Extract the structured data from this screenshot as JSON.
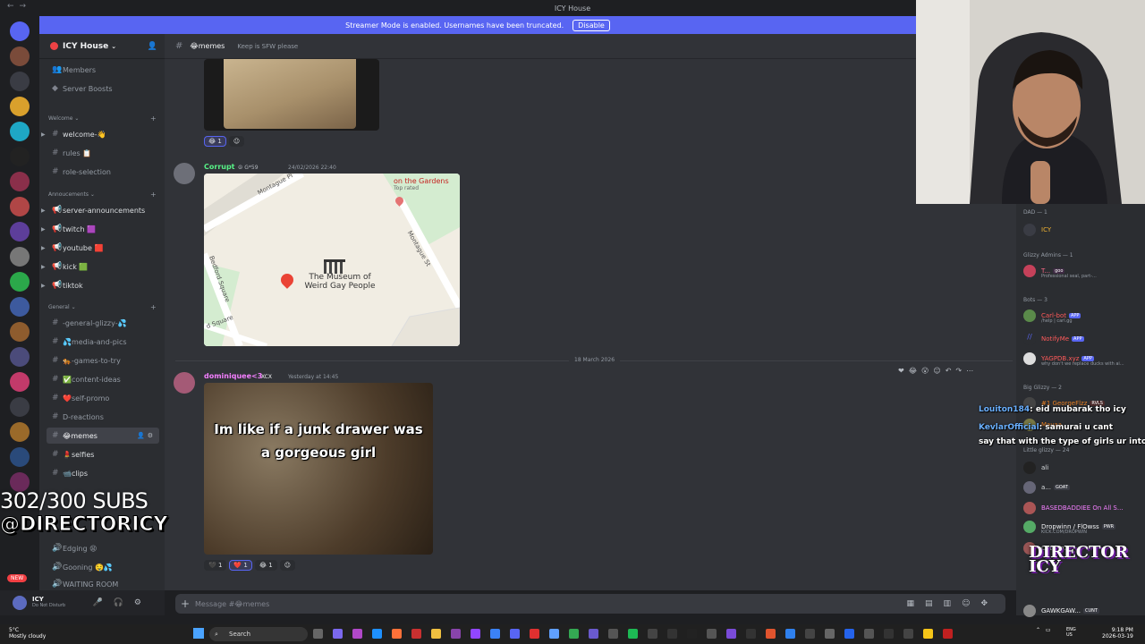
{
  "window": {
    "title": "ICY House"
  },
  "banner": {
    "text": "Streamer Mode is enabled. Usernames have been truncated.",
    "button": "Disable"
  },
  "server": {
    "name": "ICY House"
  },
  "sidebar": {
    "top_items": [
      {
        "label": "Members"
      },
      {
        "label": "Server Boosts"
      }
    ],
    "categories": [
      {
        "label": "Welcome",
        "channels": [
          "welcome-👋",
          "rules 📋",
          "role-selection"
        ]
      },
      {
        "label": "Annoucements",
        "channels": [
          "server-announcements",
          "twitch 🟪",
          "youtube 🟥",
          "kick 🟩",
          "tiktok"
        ]
      },
      {
        "label": "General",
        "channels": [
          "-general-glizzy-💦",
          "💦media-and-pics",
          "🐅-games-to-try",
          "✅content-ideas",
          "❤️self-promo",
          "D-reactions",
          "😂memes",
          "💄selfies",
          "📹clips"
        ]
      }
    ],
    "voice": [
      "Gooning 🤤💦",
      "WAITING ROOM",
      "Edging 😫"
    ]
  },
  "user": {
    "name": "ICY",
    "status": "Do Not Disturb"
  },
  "channel": {
    "name": "😂memes",
    "topic": "Keep is SFW please"
  },
  "messages": [
    {
      "reactions": [
        {
          "emoji": "😂",
          "count": "1"
        }
      ]
    },
    {
      "author": "Corrupt",
      "badge": "☮ G*59",
      "time": "24/02/2026 22:40",
      "map": {
        "place": "The Museum of Weird Gay People",
        "nearby": "on the Gardens",
        "nearby_sub": "Top rated",
        "streets": [
          "Montague Pl",
          "Montague St",
          "Bedford Square",
          "d Square"
        ]
      }
    },
    {
      "author": "dominiquee<3",
      "badge": "XCX",
      "time": "Yesterday at 14:45",
      "meme_caption": "Im like if a junk drawer was a gorgeous girl",
      "reactions": [
        {
          "emoji": "🖤",
          "count": "1"
        },
        {
          "emoji": "❤️",
          "count": "1"
        },
        {
          "emoji": "😂",
          "count": "1"
        }
      ]
    }
  ],
  "date_divider": "18 March 2026",
  "composer": {
    "placeholder": "Message #😂memes"
  },
  "members": {
    "groups": [
      {
        "label": "DAD — 1",
        "items": [
          {
            "name": "ICY"
          }
        ]
      },
      {
        "label": "Glizzy Admins — 1",
        "items": [
          {
            "name": "T...",
            "tag": "goo",
            "sub": "Professional seal, part-..."
          }
        ]
      },
      {
        "label": "Bots — 3",
        "items": [
          {
            "name": "Carl-bot",
            "tag": "APP",
            "sub": "/help | carl.gg"
          },
          {
            "name": "NotifyMe",
            "tag": "APP"
          },
          {
            "name": "YAGPDB.xyz",
            "tag": "APP",
            "sub": "why don't we replace ducks with ai..."
          }
        ]
      },
      {
        "label": "Big Glizzy — 2",
        "items": [
          {
            "name": "#1 GeorgeFlzz",
            "tag": "RVLS"
          },
          {
            "name": "Mayaa"
          }
        ]
      },
      {
        "label": "Little glizzy — 24",
        "items": [
          {
            "name": "ali"
          },
          {
            "name": "a...",
            "tag": "GOAT"
          },
          {
            "name": "BASEDBADDIEE On All S..."
          },
          {
            "name": "Dropwinn / FlOwss",
            "tag": "PWR",
            "sub": "KICK.COM/DROPWIN"
          },
          {
            "name": "Cutting..."
          },
          {
            "name": "GAWKGAW...",
            "tag": "CUNT"
          }
        ]
      }
    ]
  },
  "stream_chat": [
    {
      "user": "Louiton184",
      "text": ": eid mubarak tho icy"
    },
    {
      "user": "KevlarOfficial",
      "text": ": samurai u cant"
    },
    {
      "user": "",
      "text": "say that with the type of girls ur into"
    }
  ],
  "overlay": {
    "subs": "302/300 SUBS",
    "handle": "@DIRECTORICY",
    "logo_text": "DIRECTOR ICY"
  },
  "taskbar": {
    "weather": "5°C",
    "weather_desc": "Mostly cloudy",
    "search": "Search",
    "lang": "ENG",
    "region": "US",
    "time": "9:18 PM",
    "date": "2026-03-19"
  },
  "colors": {
    "accent": "#5865f2",
    "background": "#313338",
    "sidebar": "#2b2d31",
    "danger": "#f23f43"
  }
}
